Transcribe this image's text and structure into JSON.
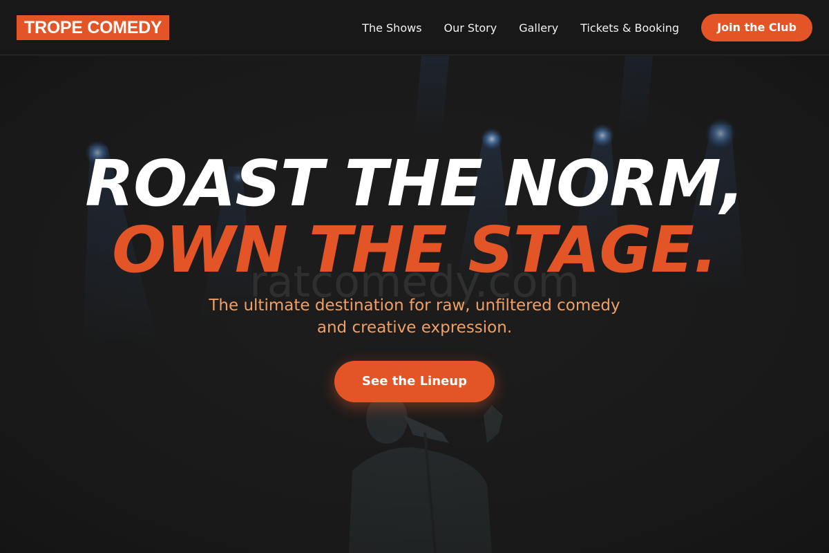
{
  "brand": {
    "logo_text": "TROPE COMEDY"
  },
  "nav": {
    "items": [
      {
        "label": "The Shows"
      },
      {
        "label": "Our Story"
      },
      {
        "label": "Gallery"
      },
      {
        "label": "Tickets & Booking"
      }
    ],
    "join_label": "Join the Club"
  },
  "hero": {
    "headline_line1": "ROAST THE NORM,",
    "headline_line2": "OWN THE STAGE.",
    "watermark": "ratcomedy.com",
    "subtitle_line1": "The ultimate destination for raw, unfiltered comedy",
    "subtitle_line2": "and creative expression.",
    "cta_label": "See the Lineup"
  },
  "colors": {
    "accent": "#e35526",
    "background": "#1b1b1b",
    "subtitle": "#f0a066",
    "stage_light": "#4a8ee0"
  }
}
